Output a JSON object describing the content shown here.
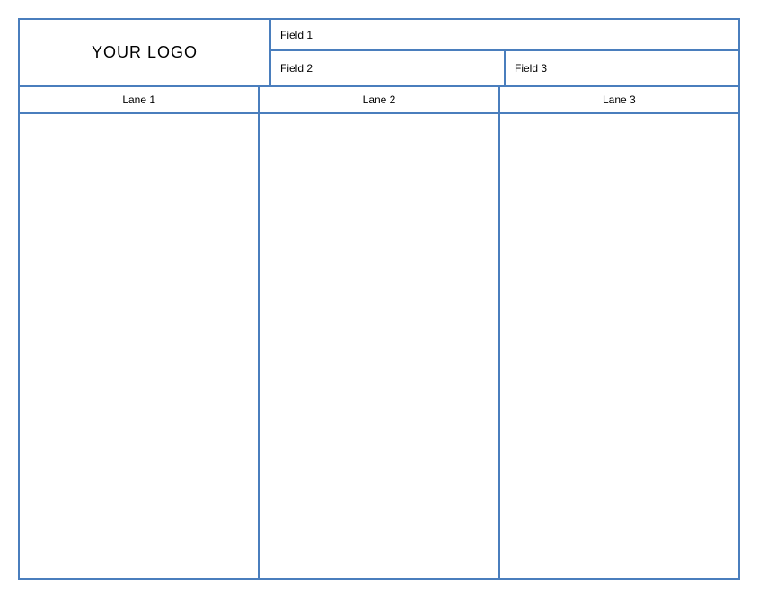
{
  "header": {
    "logo_text": "YOUR LOGO",
    "fields": {
      "field1": "Field 1",
      "field2": "Field 2",
      "field3": "Field 3"
    }
  },
  "lanes": {
    "lane1": "Lane 1",
    "lane2": "Lane 2",
    "lane3": "Lane 3"
  },
  "colors": {
    "border": "#4a7ebd"
  }
}
